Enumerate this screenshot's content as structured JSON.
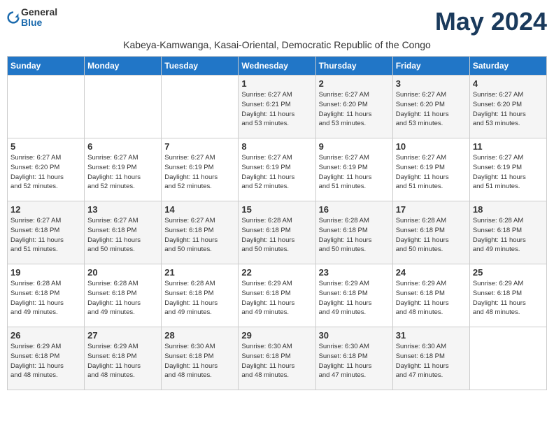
{
  "logo": {
    "text_general": "General",
    "text_blue": "Blue"
  },
  "month_title": "May 2024",
  "subtitle": "Kabeya-Kamwanga, Kasai-Oriental, Democratic Republic of the Congo",
  "days_of_week": [
    "Sunday",
    "Monday",
    "Tuesday",
    "Wednesday",
    "Thursday",
    "Friday",
    "Saturday"
  ],
  "weeks": [
    [
      {
        "day": "",
        "info": ""
      },
      {
        "day": "",
        "info": ""
      },
      {
        "day": "",
        "info": ""
      },
      {
        "day": "1",
        "info": "Sunrise: 6:27 AM\nSunset: 6:21 PM\nDaylight: 11 hours\nand 53 minutes."
      },
      {
        "day": "2",
        "info": "Sunrise: 6:27 AM\nSunset: 6:20 PM\nDaylight: 11 hours\nand 53 minutes."
      },
      {
        "day": "3",
        "info": "Sunrise: 6:27 AM\nSunset: 6:20 PM\nDaylight: 11 hours\nand 53 minutes."
      },
      {
        "day": "4",
        "info": "Sunrise: 6:27 AM\nSunset: 6:20 PM\nDaylight: 11 hours\nand 53 minutes."
      }
    ],
    [
      {
        "day": "5",
        "info": "Sunrise: 6:27 AM\nSunset: 6:20 PM\nDaylight: 11 hours\nand 52 minutes."
      },
      {
        "day": "6",
        "info": "Sunrise: 6:27 AM\nSunset: 6:19 PM\nDaylight: 11 hours\nand 52 minutes."
      },
      {
        "day": "7",
        "info": "Sunrise: 6:27 AM\nSunset: 6:19 PM\nDaylight: 11 hours\nand 52 minutes."
      },
      {
        "day": "8",
        "info": "Sunrise: 6:27 AM\nSunset: 6:19 PM\nDaylight: 11 hours\nand 52 minutes."
      },
      {
        "day": "9",
        "info": "Sunrise: 6:27 AM\nSunset: 6:19 PM\nDaylight: 11 hours\nand 51 minutes."
      },
      {
        "day": "10",
        "info": "Sunrise: 6:27 AM\nSunset: 6:19 PM\nDaylight: 11 hours\nand 51 minutes."
      },
      {
        "day": "11",
        "info": "Sunrise: 6:27 AM\nSunset: 6:19 PM\nDaylight: 11 hours\nand 51 minutes."
      }
    ],
    [
      {
        "day": "12",
        "info": "Sunrise: 6:27 AM\nSunset: 6:18 PM\nDaylight: 11 hours\nand 51 minutes."
      },
      {
        "day": "13",
        "info": "Sunrise: 6:27 AM\nSunset: 6:18 PM\nDaylight: 11 hours\nand 50 minutes."
      },
      {
        "day": "14",
        "info": "Sunrise: 6:27 AM\nSunset: 6:18 PM\nDaylight: 11 hours\nand 50 minutes."
      },
      {
        "day": "15",
        "info": "Sunrise: 6:28 AM\nSunset: 6:18 PM\nDaylight: 11 hours\nand 50 minutes."
      },
      {
        "day": "16",
        "info": "Sunrise: 6:28 AM\nSunset: 6:18 PM\nDaylight: 11 hours\nand 50 minutes."
      },
      {
        "day": "17",
        "info": "Sunrise: 6:28 AM\nSunset: 6:18 PM\nDaylight: 11 hours\nand 50 minutes."
      },
      {
        "day": "18",
        "info": "Sunrise: 6:28 AM\nSunset: 6:18 PM\nDaylight: 11 hours\nand 49 minutes."
      }
    ],
    [
      {
        "day": "19",
        "info": "Sunrise: 6:28 AM\nSunset: 6:18 PM\nDaylight: 11 hours\nand 49 minutes."
      },
      {
        "day": "20",
        "info": "Sunrise: 6:28 AM\nSunset: 6:18 PM\nDaylight: 11 hours\nand 49 minutes."
      },
      {
        "day": "21",
        "info": "Sunrise: 6:28 AM\nSunset: 6:18 PM\nDaylight: 11 hours\nand 49 minutes."
      },
      {
        "day": "22",
        "info": "Sunrise: 6:29 AM\nSunset: 6:18 PM\nDaylight: 11 hours\nand 49 minutes."
      },
      {
        "day": "23",
        "info": "Sunrise: 6:29 AM\nSunset: 6:18 PM\nDaylight: 11 hours\nand 49 minutes."
      },
      {
        "day": "24",
        "info": "Sunrise: 6:29 AM\nSunset: 6:18 PM\nDaylight: 11 hours\nand 48 minutes."
      },
      {
        "day": "25",
        "info": "Sunrise: 6:29 AM\nSunset: 6:18 PM\nDaylight: 11 hours\nand 48 minutes."
      }
    ],
    [
      {
        "day": "26",
        "info": "Sunrise: 6:29 AM\nSunset: 6:18 PM\nDaylight: 11 hours\nand 48 minutes."
      },
      {
        "day": "27",
        "info": "Sunrise: 6:29 AM\nSunset: 6:18 PM\nDaylight: 11 hours\nand 48 minutes."
      },
      {
        "day": "28",
        "info": "Sunrise: 6:30 AM\nSunset: 6:18 PM\nDaylight: 11 hours\nand 48 minutes."
      },
      {
        "day": "29",
        "info": "Sunrise: 6:30 AM\nSunset: 6:18 PM\nDaylight: 11 hours\nand 48 minutes."
      },
      {
        "day": "30",
        "info": "Sunrise: 6:30 AM\nSunset: 6:18 PM\nDaylight: 11 hours\nand 47 minutes."
      },
      {
        "day": "31",
        "info": "Sunrise: 6:30 AM\nSunset: 6:18 PM\nDaylight: 11 hours\nand 47 minutes."
      },
      {
        "day": "",
        "info": ""
      }
    ]
  ]
}
